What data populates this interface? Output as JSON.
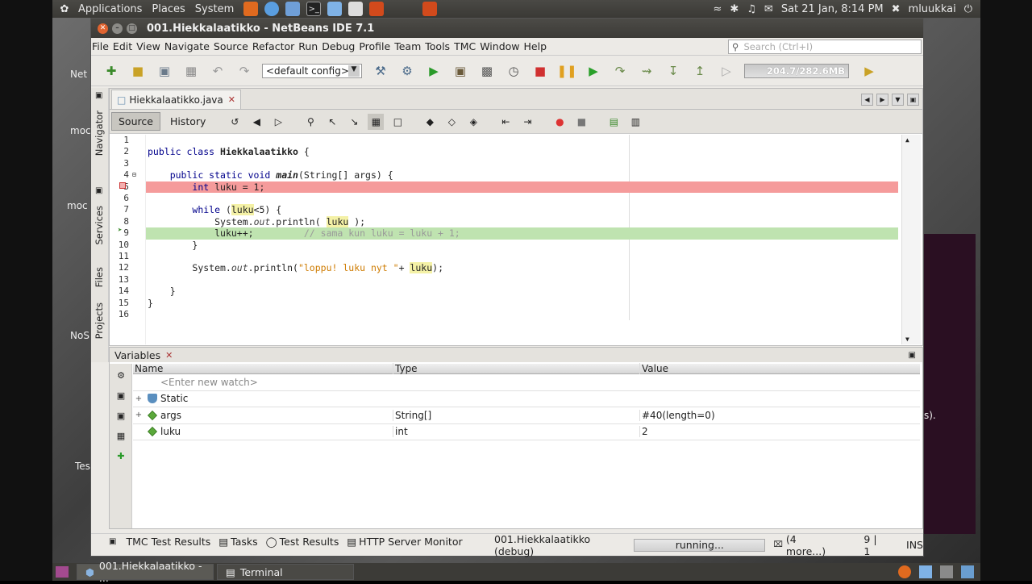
{
  "topbar": {
    "applications": "Applications",
    "places": "Places",
    "system": "System",
    "clock": "Sat 21 Jan,  8:14 PM",
    "user": "mluukkai"
  },
  "window": {
    "title": "001.Hiekkalaatikko - NetBeans IDE 7.1"
  },
  "menu": [
    "File",
    "Edit",
    "View",
    "Navigate",
    "Source",
    "Refactor",
    "Run",
    "Debug",
    "Profile",
    "Team",
    "Tools",
    "TMC",
    "Window",
    "Help"
  ],
  "search": {
    "placeholder": "Search (Ctrl+I)"
  },
  "toolbar": {
    "config": "<default config>",
    "memory": "204.7/282.6MB"
  },
  "sidebar": {
    "navigator": "Navigator",
    "services": "Services",
    "files": "Files",
    "projects": "Projects"
  },
  "editor": {
    "tab": "Hiekkalaatikko.java",
    "source": "Source",
    "history": "History"
  },
  "code_lines": [
    "1",
    "2",
    "3",
    "4",
    "5",
    "6",
    "7",
    "8",
    "9",
    "10",
    "11",
    "12",
    "13",
    "14",
    "15",
    "16"
  ],
  "code": {
    "l2_kw": "public class ",
    "l2_name": "Hiekkalaatikko",
    " l2_rest": " {",
    "l4_kw": "public static void ",
    "l4_name": "main",
    "l4_rest": "(String[] args) {",
    "l5_kw": "int",
    "l5_rest": " luku = 1;",
    "l7_kw": "while",
    "l7_a": " (",
    "l7_var": "luku",
    "l7_rest": "<5) {",
    "l8_a": "System.",
    "l8_out": "out",
    "l8_b": ".println( ",
    "l8_var": "luku",
    "l8_c": " );",
    "l9_a": "luku++;",
    "l9_cm": "// sama kun luku = luku + 1;",
    "l10": "}",
    "l12_a": "System.",
    "l12_out": "out",
    "l12_b": ".println(",
    "l12_str": "\"loppu! luku nyt \"",
    "l12_c": "+ ",
    "l12_var": "luku",
    "l12_d": ");",
    "l14": "}",
    "l15": "}"
  },
  "variables": {
    "title": "Variables",
    "headers": [
      "Name",
      "Type",
      "Value"
    ],
    "watch": "<Enter new watch>",
    "rows": [
      {
        "name": "Static",
        "type": "",
        "value": ""
      },
      {
        "name": "args",
        "type": "String[]",
        "value": "#40(length=0)"
      },
      {
        "name": "luku",
        "type": "int",
        "value": "2"
      }
    ]
  },
  "bottom_tabs": [
    "TMC Test Results",
    "Tasks",
    "Test Results",
    "HTTP Server Monitor"
  ],
  "status": {
    "project": "001.Hiekkalaatikko (debug)",
    "progress": "running...",
    "more": "(4 more...)",
    "pos": "9 | 1",
    "mode": "INS"
  },
  "taskbar": {
    "netbeans": "001.Hiekkalaatikko - ...",
    "terminal": "Terminal"
  },
  "desktop": {
    "t1": "Net",
    "t2": "moc",
    "t3": "moc",
    "t4": "NoS",
    "t5": "Tes",
    "t6": "s)."
  }
}
